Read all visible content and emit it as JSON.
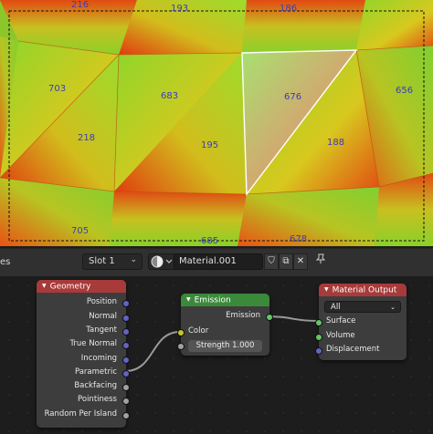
{
  "viewport": {
    "face_labels": [
      "216",
      "193",
      "186",
      "703",
      "683",
      "676",
      "656",
      "218",
      "195",
      "188",
      "705",
      "685",
      "678"
    ]
  },
  "header": {
    "editor_label": "es",
    "slot_label": "Slot 1",
    "slot_chevron": "⌄",
    "material_name": "Material.001",
    "buttons": [
      "shield-icon",
      "copy-icon",
      "close-icon",
      "pin-icon"
    ],
    "close_glyph": "✕",
    "pin_glyph": "📌",
    "copy_glyph": "⧉",
    "shield_glyph": "⛉"
  },
  "nodes": {
    "geometry": {
      "title": "Geometry",
      "header_color": "#a83a3a",
      "outputs": [
        "Position",
        "Normal",
        "Tangent",
        "True Normal",
        "Incoming",
        "Parametric",
        "Backfacing",
        "Pointiness",
        "Random Per Island"
      ]
    },
    "emission": {
      "title": "Emission",
      "header_color": "#3b8a3b",
      "output": "Emission",
      "input_color": "Color",
      "strength_label": "Strength",
      "strength_value": "1.000"
    },
    "material_output": {
      "title": "Material Output",
      "header_color": "#a83a3a",
      "target": "All",
      "inputs": [
        "Surface",
        "Volume",
        "Displacement"
      ]
    }
  },
  "colors": {
    "vector_socket": "#6363c7",
    "float_socket": "#a1a1a1",
    "color_socket": "#c7c729",
    "shader_socket": "#63c763",
    "face_label": "#3a3cb8"
  }
}
